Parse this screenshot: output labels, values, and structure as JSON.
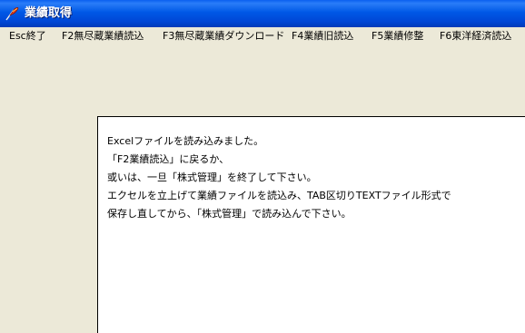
{
  "window": {
    "title": "業績取得"
  },
  "menu": {
    "items": [
      {
        "label": "Esc終了"
      },
      {
        "label": "F2無尽蔵業績読込"
      },
      {
        "label": "F3無尽蔵業績ダウンロード"
      },
      {
        "label": "F4業績旧読込"
      },
      {
        "label": "F5業績修整"
      },
      {
        "label": "F6東洋経済読込"
      }
    ]
  },
  "message": {
    "lines": [
      "Excelファイルを読み込みました。",
      "「F2業績読込」に戻るか、",
      "或いは、一旦「株式管理」を終了して下さい。",
      "エクセルを立上げて業績ファイルを読込み、TAB区切りTEXTファイル形式で",
      "保存し直してから、「株式管理」で読み込んで下さい。"
    ]
  },
  "icons": {
    "app": "app-feather-icon"
  },
  "colors": {
    "titlebar": "#0054e3",
    "window_bg": "#ece9d8",
    "panel_bg": "#ffffff"
  }
}
